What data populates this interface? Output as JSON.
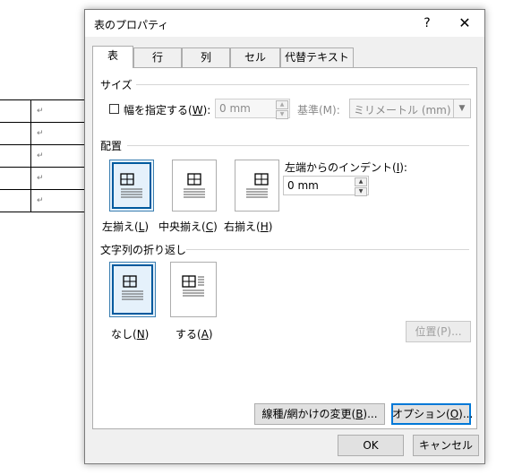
{
  "document": {
    "paragraph_mark": "↵",
    "rows": 5
  },
  "dialog": {
    "title": "表のプロパティ",
    "help_label": "?",
    "close_label": "✕",
    "tabs": [
      "表",
      "行",
      "列",
      "セル",
      "代替テキスト"
    ],
    "active_tab": "表",
    "size": {
      "heading": "サイズ",
      "width_check_label": "幅を指定する(",
      "width_check_key": "W",
      "width_check_suffix": "):",
      "width_checked": false,
      "width_value": "0 mm",
      "unit_label": "基準(M):",
      "unit_value": "ミリメートル (mm)"
    },
    "alignment": {
      "heading": "配置",
      "options": [
        {
          "label": "左揃え(",
          "key": "L",
          "suffix": ")",
          "selected": true
        },
        {
          "label": "中央揃え(",
          "key": "C",
          "suffix": ")",
          "selected": false
        },
        {
          "label": "右揃え(",
          "key": "H",
          "suffix": ")",
          "selected": false
        }
      ],
      "indent_label": "左端からのインデント(",
      "indent_key": "I",
      "indent_suffix": "):",
      "indent_value": "0 mm"
    },
    "wrapping": {
      "heading": "文字列の折り返し",
      "options": [
        {
          "label": "なし(",
          "key": "N",
          "suffix": ")",
          "selected": true
        },
        {
          "label": "する(",
          "key": "A",
          "suffix": ")",
          "selected": false
        }
      ],
      "position_button": "位置(P)..."
    },
    "borders_button": {
      "label": "線種/網かけの変更(",
      "key": "B",
      "suffix": ")..."
    },
    "options_button": {
      "label": "オプション(",
      "key": "O",
      "suffix": ")..."
    },
    "ok_button": "OK",
    "cancel_button": "キャンセル"
  },
  "colors": {
    "accent": "#0078d7",
    "selected_border": "#005a9e",
    "dialog_bg": "#f0f0f0"
  }
}
